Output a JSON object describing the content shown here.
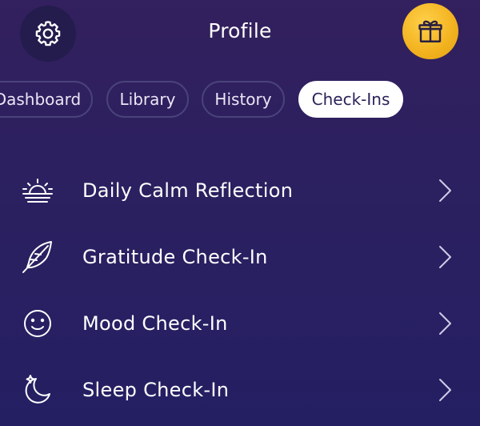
{
  "header": {
    "title": "Profile",
    "settings_icon": "gear-icon",
    "gift_icon": "gift-icon"
  },
  "tabs": [
    {
      "label": "Dashboard",
      "active": false
    },
    {
      "label": "Library",
      "active": false
    },
    {
      "label": "History",
      "active": false
    },
    {
      "label": "Check-Ins",
      "active": true
    }
  ],
  "checkins": [
    {
      "label": "Daily Calm Reflection",
      "icon": "sunrise-icon"
    },
    {
      "label": "Gratitude Check-In",
      "icon": "feather-icon"
    },
    {
      "label": "Mood Check-In",
      "icon": "smiley-icon"
    },
    {
      "label": "Sleep Check-In",
      "icon": "moon-icon"
    }
  ],
  "colors": {
    "background_top": "#33205e",
    "background_bottom": "#241f63",
    "gift_accent": "#f2b21f",
    "tab_border": "#4a437a",
    "active_tab_text": "#2a2358"
  }
}
